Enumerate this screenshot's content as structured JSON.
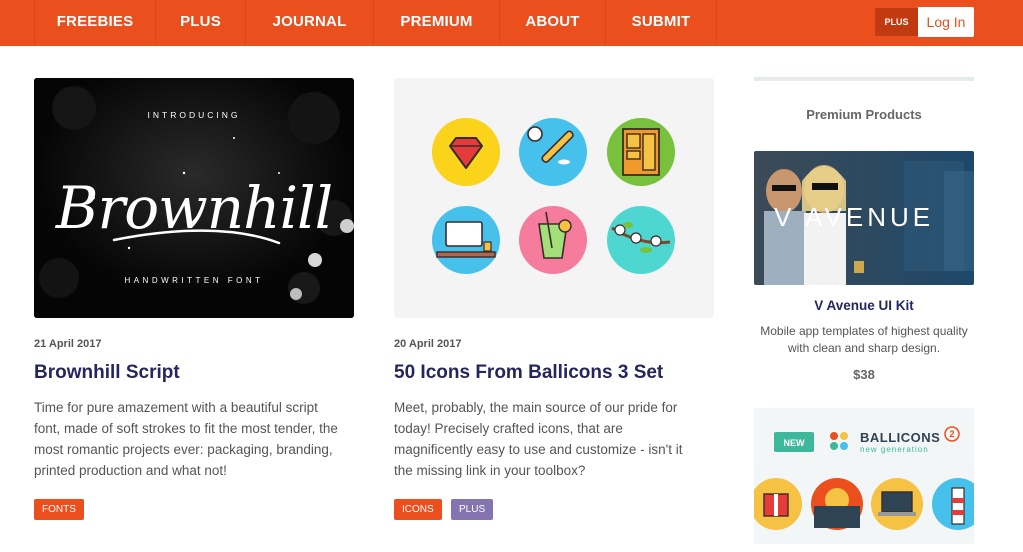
{
  "nav": {
    "items": [
      "FREEBIES",
      "PLUS",
      "JOURNAL",
      "PREMIUM",
      "ABOUT",
      "SUBMIT"
    ],
    "plus_badge": "PLUS",
    "login": "Log In"
  },
  "posts": [
    {
      "date": "21 April 2017",
      "title": "Brownhill Script",
      "description": "Time for pure amazement with a beautiful script font, made of soft strokes to fit the most tender, the most romantic projects ever: packaging, branding, printed production and what not!",
      "tags": [
        "FONTS"
      ],
      "image": {
        "top_text": "INTRODUCING",
        "script_text": "Brownhill",
        "bottom_text": "HANDWRITTEN FONT"
      }
    },
    {
      "date": "20 April 2017",
      "title": "50 Icons From Ballicons 3 Set",
      "description": "Meet, probably, the main source of our pride for today! Precisely crafted icons, that are magnificently easy to use and customize - isn't it the missing link in your toolbox?",
      "tags": [
        "ICONS",
        "PLUS"
      ],
      "image": {
        "icons": [
          "diamond-icon",
          "baseball-icon",
          "cabinet-icon",
          "computer-desk-icon",
          "cocktail-icon",
          "flower-branch-icon"
        ]
      }
    }
  ],
  "sidebar": {
    "heading": "Premium Products",
    "product1": {
      "name": "V Avenue UI Kit",
      "description": "Mobile app templates of highest quality with clean and sharp design.",
      "price": "$38",
      "image_text": "V AVENUE"
    },
    "product2": {
      "badge": "NEW",
      "brand": "BALLICONS",
      "subtitle": "new generation",
      "number": "2"
    }
  },
  "colors": {
    "brand_orange": "#ea4f1d",
    "title_navy": "#25265e",
    "tag_plus_purple": "#8474b0"
  }
}
